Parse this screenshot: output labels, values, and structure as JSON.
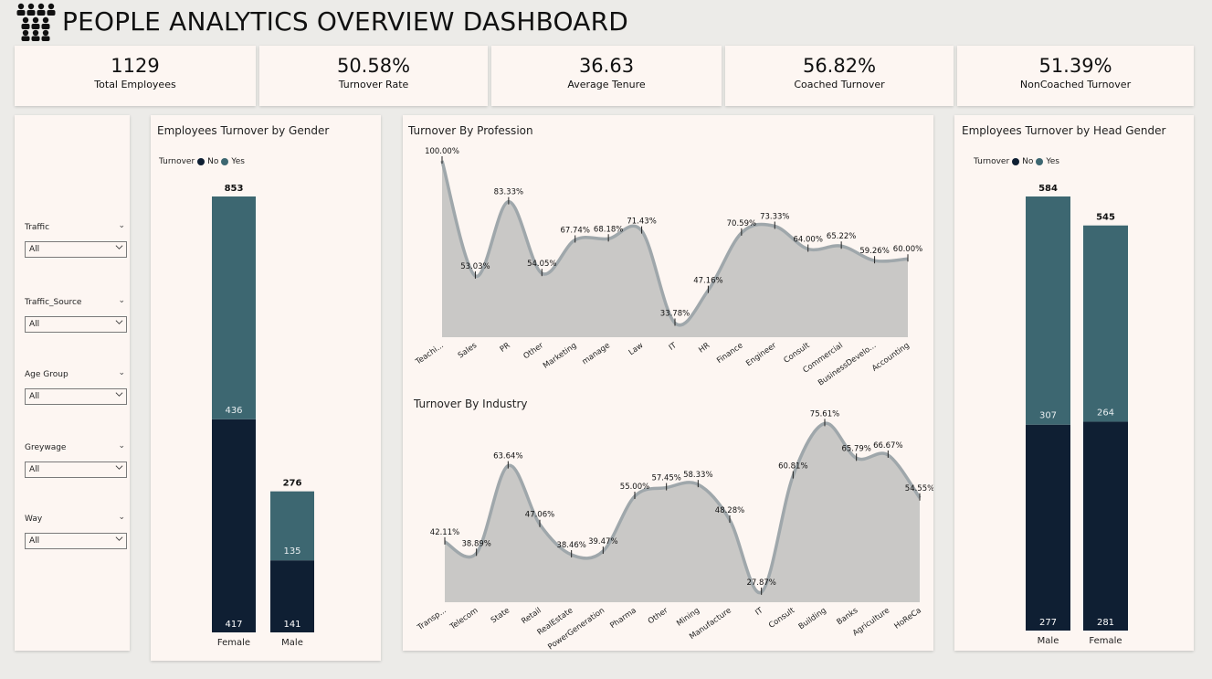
{
  "title": "PEOPLE ANALYTICS OVERVIEW DASHBOARD",
  "logo_icon": "people-group-icon",
  "kpis": [
    {
      "value": "1129",
      "label": "Total Employees"
    },
    {
      "value": "50.58%",
      "label": "Turnover Rate"
    },
    {
      "value": "36.63",
      "label": "Average Tenure"
    },
    {
      "value": "56.82%",
      "label": "Coached Turnover"
    },
    {
      "value": "51.39%",
      "label": "NonCoached Turnover"
    }
  ],
  "slicers": [
    {
      "label": "Traffic",
      "value": "All"
    },
    {
      "label": "Traffic_Source",
      "value": "All"
    },
    {
      "label": "Age Group",
      "value": "All"
    },
    {
      "label": "Greywage",
      "value": "All"
    },
    {
      "label": "Way",
      "value": "All"
    }
  ],
  "colors": {
    "no": "#0f1f33",
    "yes": "#3d6771",
    "area": "#c9c8c6",
    "line": "#9fa7ab",
    "bg": "#fdf6f2"
  },
  "legend": {
    "title": "Turnover",
    "no": "No",
    "yes": "Yes"
  },
  "chart_data": [
    {
      "type": "bar",
      "stacked": true,
      "title": "Employees Turnover by Gender",
      "categories": [
        "Female",
        "Male"
      ],
      "series": [
        {
          "name": "No",
          "values": [
            417,
            141
          ]
        },
        {
          "name": "Yes",
          "values": [
            436,
            135
          ]
        }
      ],
      "totals": [
        853,
        276
      ]
    },
    {
      "type": "area",
      "title": "Turnover By Profession",
      "categories": [
        "Teachi...",
        "Sales",
        "PR",
        "Other",
        "Marketing",
        "manage",
        "Law",
        "IT",
        "HR",
        "Finance",
        "Engineer",
        "Consult",
        "Commercial",
        "BusinessDevelo...",
        "Accounting"
      ],
      "values": [
        100.0,
        53.03,
        83.33,
        54.05,
        67.74,
        68.18,
        71.43,
        33.78,
        47.16,
        70.59,
        73.33,
        64.0,
        65.22,
        59.26,
        60.0
      ],
      "labels": [
        "100.00%",
        "53.03%",
        "83.33%",
        "54.05%",
        "67.74%",
        "68.18%",
        "71.43%",
        "33.78%",
        "47.16%",
        "70.59%",
        "73.33%",
        "64.00%",
        "65.22%",
        "59.26%",
        "60.00%"
      ]
    },
    {
      "type": "area",
      "title": "Turnover By Industry",
      "categories": [
        "Transp...",
        "Telecom",
        "State",
        "Retail",
        "RealEstate",
        "PowerGeneration",
        "Pharma",
        "Other",
        "Mining",
        "Manufacture",
        "IT",
        "Consult",
        "Building",
        "Banks",
        "Agriculture",
        "HoReCa"
      ],
      "values": [
        42.11,
        38.89,
        63.64,
        47.06,
        38.46,
        39.47,
        55.0,
        57.45,
        58.33,
        48.28,
        27.87,
        60.81,
        75.61,
        65.79,
        66.67,
        54.55
      ],
      "labels": [
        "42.11%",
        "38.89%",
        "63.64%",
        "47.06%",
        "38.46%",
        "39.47%",
        "55.00%",
        "57.45%",
        "58.33%",
        "48.28%",
        "27.87%",
        "60.81%",
        "75.61%",
        "65.79%",
        "66.67%",
        "54.55%"
      ]
    },
    {
      "type": "bar",
      "stacked": true,
      "title": "Employees Turnover by Head Gender",
      "categories": [
        "Male",
        "Female"
      ],
      "series": [
        {
          "name": "No",
          "values": [
            277,
            281
          ]
        },
        {
          "name": "Yes",
          "values": [
            307,
            264
          ]
        }
      ],
      "totals": [
        584,
        545
      ]
    }
  ]
}
